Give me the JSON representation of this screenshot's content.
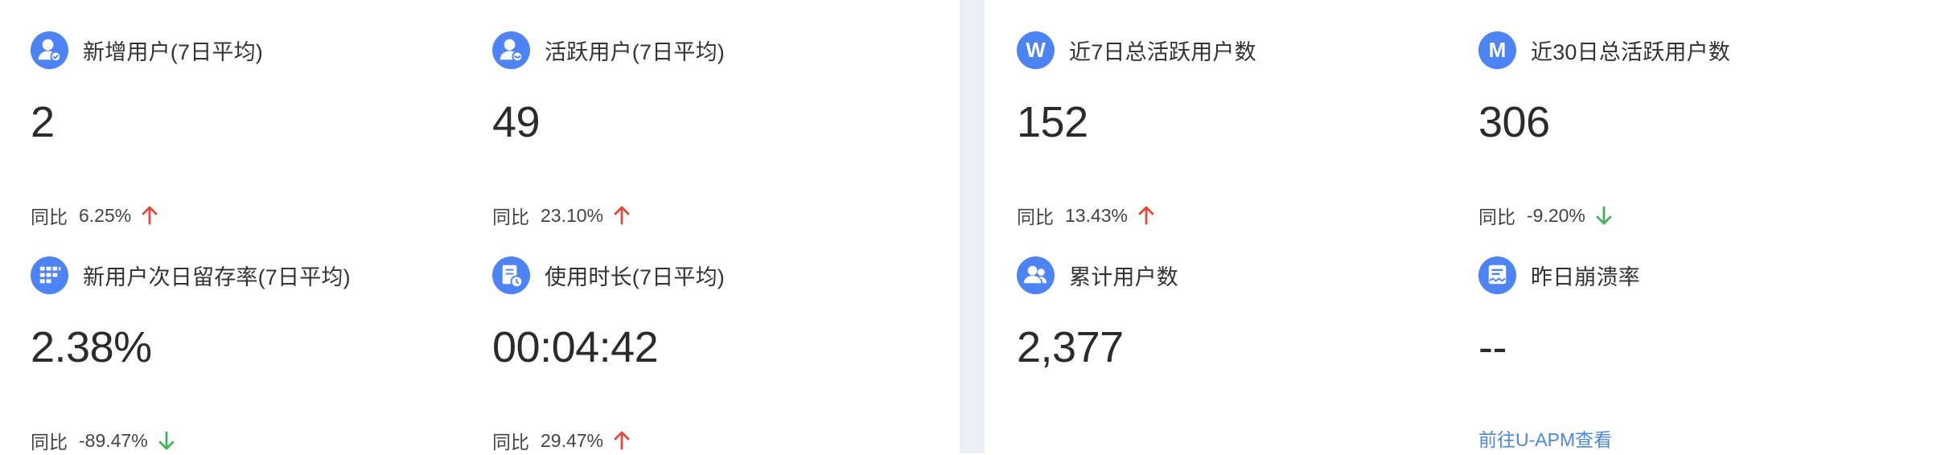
{
  "colors": {
    "accent": "#4d84f5",
    "up_arrow": "#e5483b",
    "down_arrow": "#43b35a",
    "link": "#4a86e8",
    "divider": "#eceef5"
  },
  "left_panel": {
    "cards": [
      {
        "icon": "new-user-icon",
        "title": "新增用户(7日平均)",
        "value": "2",
        "compare_label": "同比",
        "compare_value": "6.25%",
        "trend": "up"
      },
      {
        "icon": "active-user-icon",
        "title": "活跃用户(7日平均)",
        "value": "49",
        "compare_label": "同比",
        "compare_value": "23.10%",
        "trend": "up"
      },
      {
        "icon": "retention-grid-icon",
        "title": "新用户次日留存率(7日平均)",
        "value": "2.38%",
        "compare_label": "同比",
        "compare_value": "-89.47%",
        "trend": "down"
      },
      {
        "icon": "usage-duration-icon",
        "title": "使用时长(7日平均)",
        "value": "00:04:42",
        "compare_label": "同比",
        "compare_value": "29.47%",
        "trend": "up"
      }
    ]
  },
  "right_panel": {
    "cards": [
      {
        "icon": "weekly-w-icon",
        "icon_letter": "W",
        "title": "近7日总活跃用户数",
        "value": "152",
        "compare_label": "同比",
        "compare_value": "13.43%",
        "trend": "up"
      },
      {
        "icon": "monthly-m-icon",
        "icon_letter": "M",
        "title": "近30日总活跃用户数",
        "value": "306",
        "compare_label": "同比",
        "compare_value": "-9.20%",
        "trend": "down"
      },
      {
        "icon": "cumulative-users-icon",
        "title": "累计用户数",
        "value": "2,377"
      },
      {
        "icon": "crash-report-icon",
        "title": "昨日崩溃率",
        "value": "--",
        "link_text": "前往U-APM查看"
      }
    ]
  }
}
